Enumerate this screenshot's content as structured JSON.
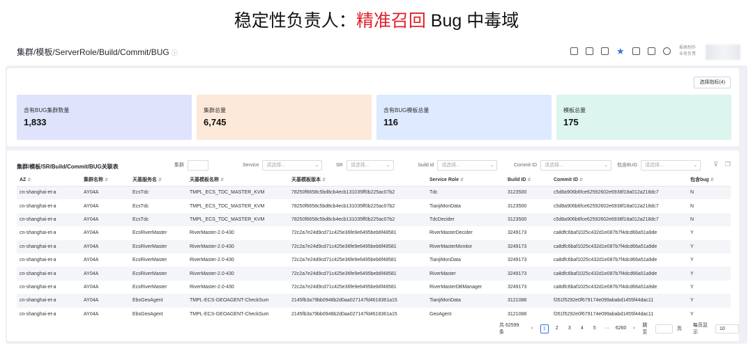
{
  "slide": {
    "title_prefix": "稳定性负责人：",
    "title_highlight": "精准召回",
    "title_suffix": " Bug 中毒域"
  },
  "page": {
    "path": "集群/模板/ServerRole/Build/Commit/BUG",
    "info_icon": "ⓘ",
    "owner_line1": "报表制作",
    "owner_line2": "业务负责"
  },
  "toolbar": {
    "icons": [
      "share-icon",
      "mail-icon",
      "screen-icon",
      "star-icon",
      "subscribe-icon",
      "edit-icon",
      "more-icon"
    ]
  },
  "metrics_button": "选择指标(4)",
  "kpis": [
    {
      "label": "含有BUG集群数量",
      "value": "1,833",
      "color": "#dfe3fc"
    },
    {
      "label": "集群总量",
      "value": "6,745",
      "color": "#fde9d9"
    },
    {
      "label": "含有BUG模板总量",
      "value": "116",
      "color": "#ddeaff"
    },
    {
      "label": "模板总量",
      "value": "175",
      "color": "#dcf5ee"
    }
  ],
  "table": {
    "title": "集群/模板/SR/Build/Commit/BUG关联表",
    "filters": [
      {
        "label": "集群",
        "placeholder": ""
      },
      {
        "label": "Service",
        "placeholder": "请选择..."
      },
      {
        "label": "SR",
        "placeholder": "请选择..."
      },
      {
        "label": "build id",
        "placeholder": "请选择..."
      },
      {
        "label": "Commit ID",
        "placeholder": "请选择..."
      },
      {
        "label": "包含BUG",
        "placeholder": "请选择..."
      }
    ],
    "columns": [
      "AZ",
      "集群名称",
      "天基服务名",
      "天基模板名称",
      "天基模板版本",
      "Service Role",
      "Build ID",
      "Commit ID",
      "包含bug"
    ],
    "rows": [
      [
        "cn-shanghai-et-a",
        "AY04A",
        "EcsTdc",
        "TMPL_ECS_TDC_MASTER_KVM",
        "78250f6658c5bd8cb4ecb131035ff0b225ac07b2",
        "Tdc",
        "3123500",
        "c5d8a906b6fce62592602e6938f18a012a218dc7",
        "N"
      ],
      [
        "cn-shanghai-et-a",
        "AY04A",
        "EcsTdc",
        "TMPL_ECS_TDC_MASTER_KVM",
        "78250f6658c5bd8cb4ecb131035ff0b225ac07b2",
        "TianjiMonData",
        "3123500",
        "c5d8a906b6fce62592602e6938f18a012a218dc7",
        "N"
      ],
      [
        "cn-shanghai-et-a",
        "AY04A",
        "EcsTdc",
        "TMPL_ECS_TDC_MASTER_KVM",
        "78250f6658c5bd8cb4ecb131035ff0b225ac07b2",
        "TdcDecider",
        "3123500",
        "c5d8a906b6fce62592602e6938f18a012a218dc7",
        "N"
      ],
      [
        "cn-shanghai-et-a",
        "AY04A",
        "EcsRiverMaster",
        "RiverMaster-2.0-430",
        "72c2a7e24d9cd71c425e36fe9e6495beb6f48581",
        "RiverMasterDecider",
        "3249173",
        "ca8dfc6baf1025c432d1e087b7f4dcd66a51a9de",
        "Y"
      ],
      [
        "cn-shanghai-et-a",
        "AY04A",
        "EcsRiverMaster",
        "RiverMaster-2.0-430",
        "72c2a7e24d9cd71c425e36fe9e6495beb6f48581",
        "RiverMasterMonitor",
        "3249173",
        "ca8dfc6baf1025c432d1e087b7f4dcd66a51a9de",
        "Y"
      ],
      [
        "cn-shanghai-et-a",
        "AY04A",
        "EcsRiverMaster",
        "RiverMaster-2.0-430",
        "72c2a7e24d9cd71c425e36fe9e6495beb6f48581",
        "TianjiMonData",
        "3249173",
        "ca8dfc6baf1025c432d1e087b7f4dcd66a51a9de",
        "Y"
      ],
      [
        "cn-shanghai-et-a",
        "AY04A",
        "EcsRiverMaster",
        "RiverMaster-2.0-430",
        "72c2a7e24d9cd71c425e36fe9e6495beb6f48581",
        "RiverMaster",
        "3249173",
        "ca8dfc6baf1025c432d1e087b7f4dcd66a51a9de",
        "Y"
      ],
      [
        "cn-shanghai-et-a",
        "AY04A",
        "EcsRiverMaster",
        "RiverMaster-2.0-430",
        "72c2a7e24d9cd71c425e36fe9e6495beb6f48581",
        "RiverMasterDBManager",
        "3249173",
        "ca8dfc6baf1025c432d1e087b7f4dcd66a51a9de",
        "Y"
      ],
      [
        "cn-shanghai-et-a",
        "AY04A",
        "EbsGeoAgent",
        "TMPL-ECS-GEOAGENT-CheckSum",
        "2145fb3a79bb0948b2d0aa027147fd4618361a15",
        "TianjiMonData",
        "3121088",
        "f261f5292e0f679174e099ababd1455f44dac11",
        "Y"
      ],
      [
        "cn-shanghai-et-a",
        "AY04A",
        "EbsGeoAgent",
        "TMPL-ECS-GEOAGENT-CheckSum",
        "2145fb3a79bb0948b2d0aa027147fd4618361a15",
        "GeoAgent",
        "3121088",
        "f261f5292e0f679174e099ababd1455f44dac11",
        "Y"
      ]
    ]
  },
  "pager": {
    "total": "共 62599 条",
    "prev": "‹",
    "pages": [
      "1",
      "2",
      "3",
      "4",
      "5"
    ],
    "ellipsis": "···",
    "last": "6260",
    "next": "›",
    "jump_label": "跳至",
    "page_unit": "页",
    "size_label": "每页显示",
    "page_size": "10"
  }
}
